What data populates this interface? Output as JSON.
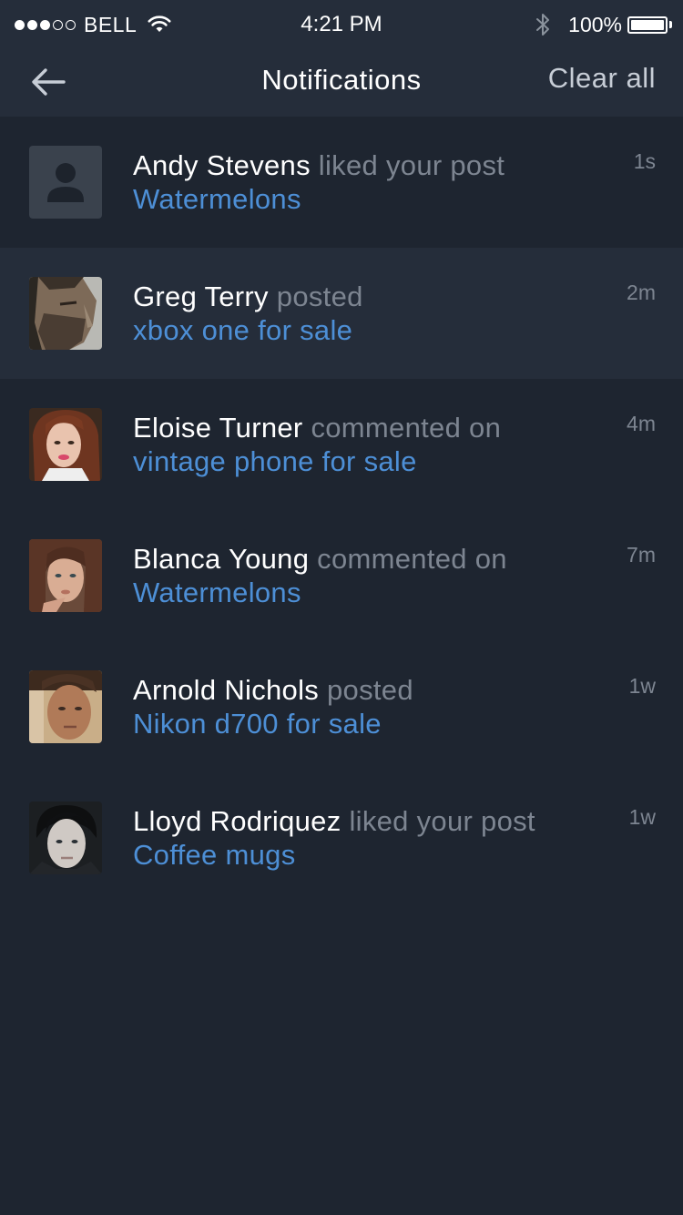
{
  "status_bar": {
    "signal_bars_on": 3,
    "signal_bars_total": 5,
    "carrier": "BELL",
    "time": "4:21 PM",
    "battery_text": "100%",
    "battery_level": 1.0,
    "icons": [
      "wifi-icon",
      "bluetooth-icon",
      "battery-icon"
    ]
  },
  "nav": {
    "back_icon": "arrow-left-icon",
    "title": "Notifications",
    "clear_label": "Clear all"
  },
  "colors": {
    "background": "#1e2530",
    "bar_background": "#252d3a",
    "highlight_row": "#252d3a",
    "name_text": "#ffffff",
    "action_text": "#7d8591",
    "link_text": "#4d8fd6"
  },
  "notifications": [
    {
      "name": "Andy Stevens",
      "action": " liked your post",
      "target": "Watermelons",
      "time": "1s",
      "avatar": "placeholder",
      "highlight": false
    },
    {
      "name": "Greg Terry",
      "action": " posted",
      "target": "xbox one for sale",
      "time": "2m",
      "avatar": "photo",
      "highlight": true
    },
    {
      "name": "Eloise Turner",
      "action": " commented on",
      "target": "vintage phone for sale",
      "time": "4m",
      "avatar": "photo",
      "highlight": false
    },
    {
      "name": "Blanca  Young",
      "action": " commented on",
      "target": "Watermelons",
      "time": "7m",
      "avatar": "photo",
      "highlight": false
    },
    {
      "name": "Arnold Nichols",
      "action": " posted",
      "target": "Nikon d700 for sale",
      "time": "1w",
      "avatar": "photo",
      "highlight": false
    },
    {
      "name": "Lloyd Rodriquez",
      "action": " liked your post",
      "target": "Coffee mugs",
      "time": "1w",
      "avatar": "photo",
      "highlight": false
    }
  ]
}
